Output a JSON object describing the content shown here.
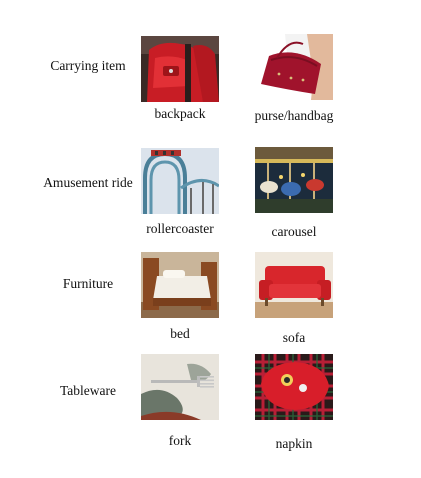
{
  "rows": [
    {
      "category": "Carrying item",
      "left": "backpack",
      "right": "purse/handbag"
    },
    {
      "category": "Amusement ride",
      "left": "rollercoaster",
      "right": "carousel"
    },
    {
      "category": "Furniture",
      "left": "bed",
      "right": "sofa"
    },
    {
      "category": "Tableware",
      "left": "fork",
      "right": "napkin"
    }
  ],
  "icons": {
    "backpack": "backpack-photo-icon",
    "purse": "handbag-photo-icon",
    "rollercoaster": "rollercoaster-photo-icon",
    "carousel": "carousel-photo-icon",
    "bed": "bed-photo-icon",
    "sofa": "sofa-photo-icon",
    "fork": "fork-photo-icon",
    "napkin": "napkin-photo-icon"
  },
  "colors": {
    "red": "#d81e2a",
    "sky": "#dbe3ec"
  }
}
